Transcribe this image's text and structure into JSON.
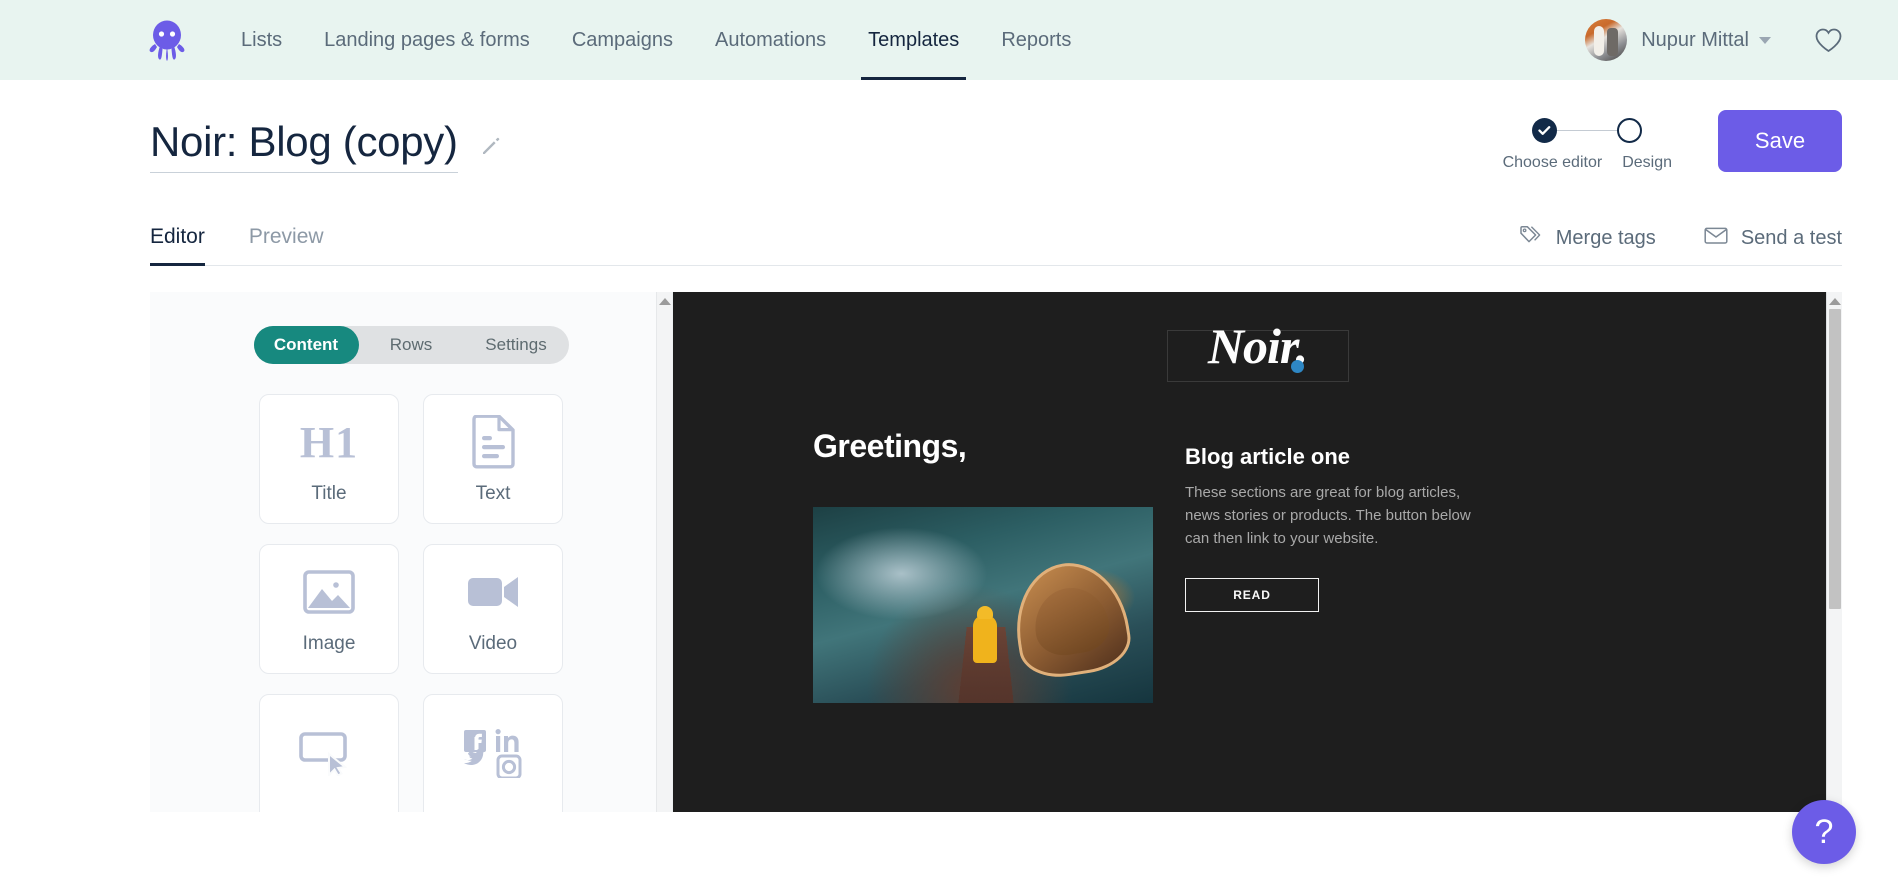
{
  "nav": {
    "logo_icon": "octopus-logo",
    "links": [
      {
        "label": "Lists",
        "active": false
      },
      {
        "label": "Landing pages & forms",
        "active": false
      },
      {
        "label": "Campaigns",
        "active": false
      },
      {
        "label": "Automations",
        "active": false
      },
      {
        "label": "Templates",
        "active": true
      },
      {
        "label": "Reports",
        "active": false
      }
    ],
    "user_name": "Nupur Mittal",
    "caret_icon": "chevron-down-icon",
    "favorites_icon": "heart-icon"
  },
  "header": {
    "title": "Noir: Blog (copy)",
    "edit_icon": "pencil-icon",
    "stepper": {
      "step1_label": "Choose editor",
      "step2_label": "Design",
      "step1_state": "complete",
      "step2_state": "current",
      "check_icon": "check-icon"
    },
    "save_label": "Save",
    "accent_purple": "#6c5ce7"
  },
  "tabs": {
    "items": [
      {
        "label": "Editor",
        "active": true
      },
      {
        "label": "Preview",
        "active": false
      }
    ],
    "actions": [
      {
        "label": "Merge tags",
        "icon": "tag-icon"
      },
      {
        "label": "Send a test",
        "icon": "envelope-icon"
      }
    ]
  },
  "editor": {
    "segments": [
      {
        "label": "Content",
        "active": true
      },
      {
        "label": "Rows",
        "active": false
      },
      {
        "label": "Settings",
        "active": false
      }
    ],
    "segment_active_color": "#17897f",
    "blocks": [
      {
        "label": "Title",
        "icon": "heading-h1-icon",
        "glyph": "H1"
      },
      {
        "label": "Text",
        "icon": "document-text-icon"
      },
      {
        "label": "Image",
        "icon": "image-icon"
      },
      {
        "label": "Video",
        "icon": "video-camera-icon"
      },
      {
        "label": "",
        "icon": "button-cursor-icon"
      },
      {
        "label": "",
        "icon": "social-icons-icon"
      }
    ],
    "scrollbar_icon": "scroll-up-arrow-icon"
  },
  "preview": {
    "background": "#1e1e1e",
    "logo_text": "Noir.",
    "logo_dot_color": "#2e87c4",
    "greeting": "Greetings,",
    "photo_alt": "person-in-yellow-raincoat-on-dock-with-wooden-boat",
    "article_title": "Blog article one",
    "article_body": "These sections are great for blog articles, news stories or products. The button below can then link to your website.",
    "read_button": "READ",
    "scrollbar_icon": "scroll-up-arrow-icon"
  },
  "help": {
    "label": "?",
    "icon": "question-mark-icon"
  }
}
